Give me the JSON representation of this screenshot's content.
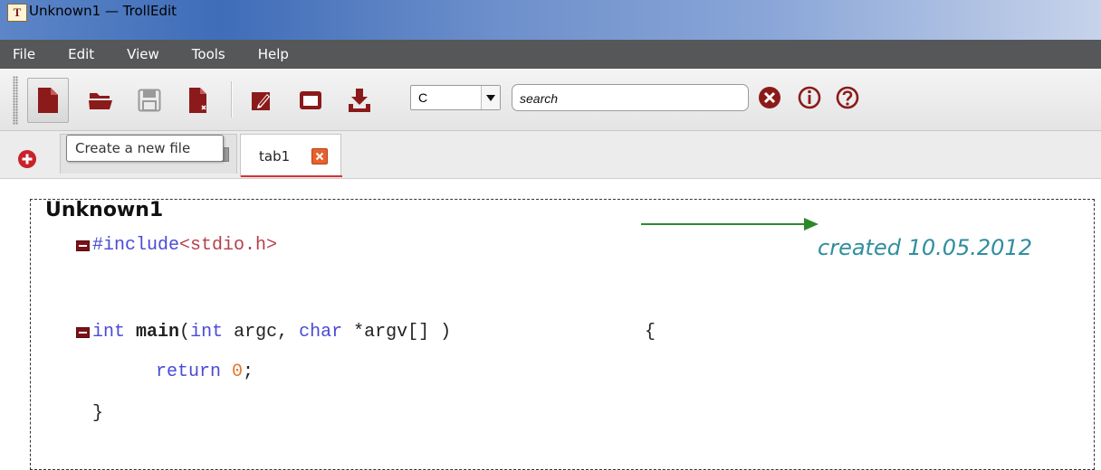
{
  "window": {
    "title": "Unknown1 — TrollEdit",
    "app_icon": "trolledit-app-icon"
  },
  "menu": {
    "items": [
      "File",
      "Edit",
      "View",
      "Tools",
      "Help"
    ]
  },
  "toolbar": {
    "buttons": [
      {
        "name": "new-file-button",
        "icon": "new-file-icon"
      },
      {
        "name": "open-file-button",
        "icon": "folder-icon"
      },
      {
        "name": "save-file-button",
        "icon": "floppy-icon"
      },
      {
        "name": "close-file-button",
        "icon": "close-file-icon"
      },
      {
        "name": "edit-button",
        "icon": "pencil-icon"
      },
      {
        "name": "window-button",
        "icon": "window-icon"
      },
      {
        "name": "import-button",
        "icon": "download-icon"
      }
    ],
    "language_value": "C",
    "search_placeholder": "search",
    "clear_icon": "clear-x-icon",
    "info_icon": "info-icon",
    "help_icon": "help-question-icon",
    "accent_color": "#8b1a1a"
  },
  "tabs": {
    "tooltip": "Create a new file",
    "items": [
      {
        "label": "tab1",
        "active": true
      }
    ],
    "close_color": "#e8612c",
    "active_underline_color": "#d63333"
  },
  "editor": {
    "doc_title": "Unknown1",
    "annotation": "created 10.05.2012",
    "annotation_color": "#2f8e9e",
    "arrow_color": "#2a8a2a",
    "code": {
      "line1": {
        "directive": "#include",
        "header": "<stdio.h>"
      },
      "line2": {
        "kw1": "int",
        "fn": "main",
        "paren_open": "(",
        "kw2": "int",
        "arg1": " argc, ",
        "kw3": "char",
        "rest": " *argv[] )",
        "brace": "{"
      },
      "line3": {
        "kw": "return",
        "num": "0",
        "semi": ";"
      },
      "line4": {
        "brace": "}"
      }
    }
  }
}
